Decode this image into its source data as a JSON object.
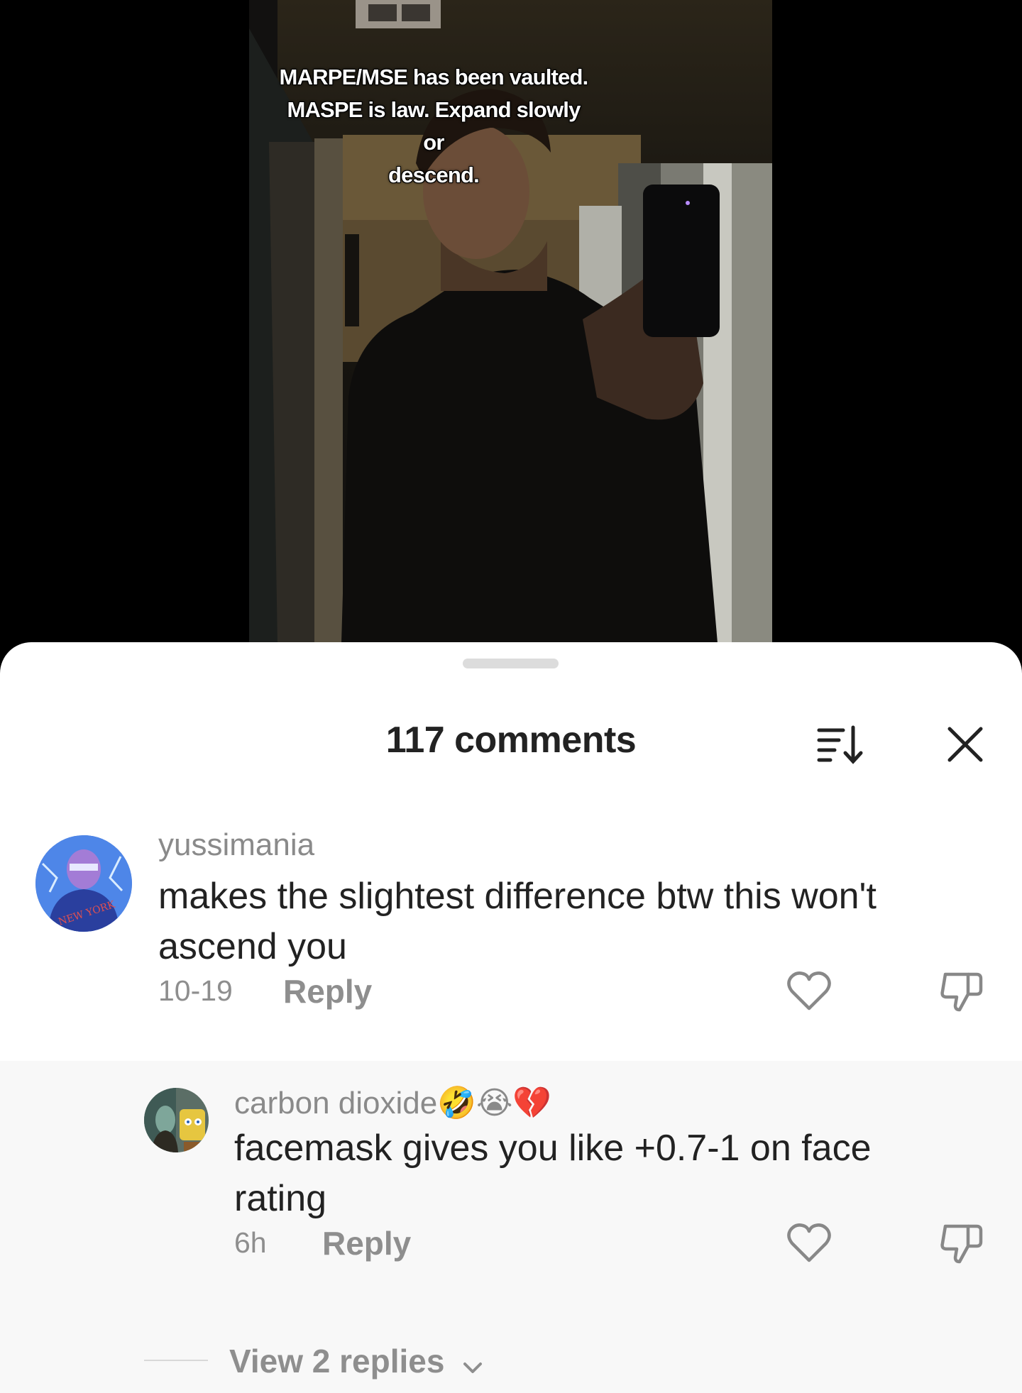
{
  "video": {
    "caption_lines": [
      "MARPE/MSE has been vaulted.",
      "MASPE is law. Expand slowly or",
      "descend."
    ]
  },
  "sheet": {
    "title": "117 comments",
    "sort_icon": "sort-icon",
    "close_icon": "close-icon"
  },
  "comments": [
    {
      "username": "yussimania",
      "text_lines": [
        "makes the slightest difference btw this won't",
        "ascend you"
      ],
      "time": "10-19",
      "reply_label": "Reply",
      "avatar_icon": "avatar-user-photo"
    },
    {
      "username": "carbon dioxide🤣😭💔",
      "text_lines": [
        "facemask gives you like +0.7-1 on face",
        "rating"
      ],
      "time": "6h",
      "reply_label": "Reply",
      "avatar_icon": "avatar-user-photo"
    }
  ],
  "view_replies": {
    "label": "View 2 replies"
  },
  "colors": {
    "sheet_bg": "#ffffff",
    "reply_bg": "#f8f8f8",
    "secondary_text": "#8e8e8e",
    "primary_text": "#222222"
  }
}
